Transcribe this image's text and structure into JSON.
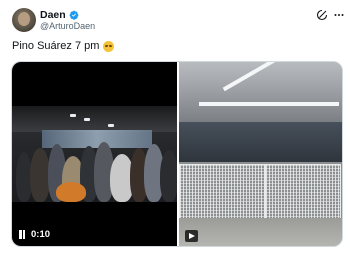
{
  "tweet": {
    "display_name": "Daen",
    "handle": "@ArturoDaen",
    "verified": true,
    "text": "Pino Suárez 7 pm",
    "emoji": "pleading-face-emoji"
  },
  "actions": {
    "grok_icon": "grok-icon",
    "more_icon": "more-icon"
  },
  "media": {
    "video": {
      "time": "0:10",
      "state": "playing"
    },
    "photo": {
      "kind": "gif-or-video-thumbnail"
    }
  },
  "colors": {
    "accent": "#1d9bf0",
    "text_primary": "#0f1419",
    "text_secondary": "#536471",
    "border": "#cfd9de"
  }
}
